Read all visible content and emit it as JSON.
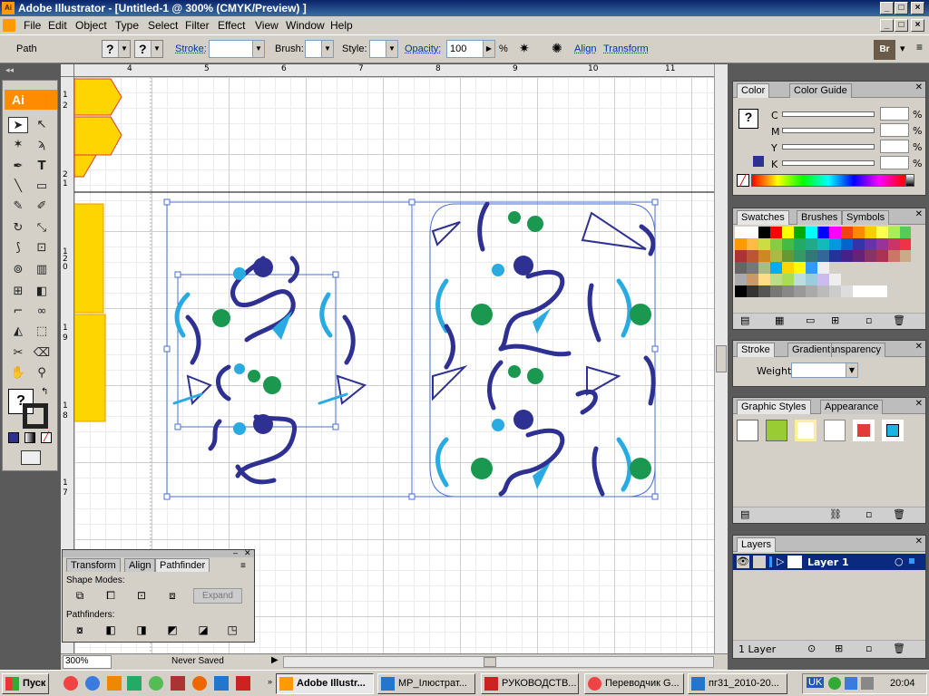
{
  "window": {
    "title": "Adobe Illustrator - [Untitled-1 @ 300% (CMYK/Preview) ]",
    "app_icon": "Ai"
  },
  "menu": [
    "File",
    "Edit",
    "Object",
    "Type",
    "Select",
    "Filter",
    "Effect",
    "View",
    "Window",
    "Help"
  ],
  "control": {
    "selection": "Path",
    "fill_q": "?",
    "stroke_q": "?",
    "stroke_label": "Stroke:",
    "brush_label": "Brush:",
    "style_label": "Style:",
    "opacity_label": "Opacity:",
    "opacity_value": "100",
    "percent": "%",
    "align": "Align",
    "transform": "Transform",
    "bridge": "Br"
  },
  "tools": {
    "logo": "Ai",
    "fill_q": "?"
  },
  "ruler": {
    "h": [
      "4",
      "5",
      "6",
      "7",
      "8",
      "9",
      "10",
      "11"
    ],
    "v_top": [
      "1",
      "2",
      "2",
      "1"
    ],
    "v_mid": [
      "1",
      "2",
      "0",
      "1",
      "9",
      "1",
      "8",
      "1",
      "7"
    ]
  },
  "status": {
    "zoom": "300%",
    "saved": "Never Saved"
  },
  "color_panel": {
    "tabs": [
      "Color",
      "Color Guide"
    ],
    "channels": [
      "C",
      "M",
      "Y",
      "K"
    ],
    "percent": "%"
  },
  "swatches_panel": {
    "tabs": [
      "Swatches",
      "Brushes",
      "Symbols"
    ]
  },
  "stroke_panel": {
    "tabs": [
      "Stroke",
      "Gradient",
      "Transparency"
    ],
    "weight_label": "Weight:"
  },
  "graphic_styles_panel": {
    "tabs": [
      "Graphic Styles",
      "Appearance"
    ]
  },
  "layers_panel": {
    "tab": "Layers",
    "layer_name": "Layer 1",
    "footer": "1 Layer"
  },
  "pathfinder_panel": {
    "tabs": [
      "Transform",
      "Align",
      "Pathfinder"
    ],
    "shape_modes": "Shape Modes:",
    "expand": "Expand",
    "pathfinders": "Pathfinders:"
  },
  "taskbar": {
    "start": "Пуск",
    "tasks": [
      "Adobe Illustr...",
      "МР_Ілюстрат...",
      "РУКОВОДСТВ...",
      "Переводчик G...",
      "пг31_2010-20..."
    ],
    "lang": "UK",
    "clock": "20:04"
  },
  "colors": {
    "dark_blue": "#2e3192",
    "cyan": "#29abe2",
    "green": "#1a9850",
    "yellow": "#fff200",
    "selection_blue": "#4a6fd9"
  }
}
